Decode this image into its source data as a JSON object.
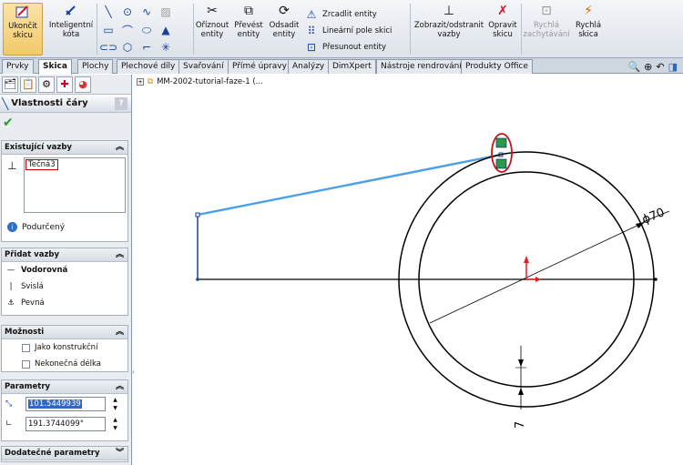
{
  "ribbon": {
    "exit_sketch": "Ukončit skicu",
    "smart_dimension": "Inteligentní kóta",
    "trim": "Oříznout entity",
    "convert": "Převést entity",
    "offset": "Odsadit entity",
    "mirror": "Zrcadlit entity",
    "linear_pattern": "Lineární pole skici",
    "move": "Přesunout entity",
    "display_relations": "Zobrazit/odstranit vazby",
    "repair": "Opravit skicu",
    "quick_snaps": "Rychlá zachytávání",
    "rapid_sketch": "Rychlá skica"
  },
  "tabs": [
    "Prvky",
    "Skica",
    "Plochy",
    "Plechové díly",
    "Svařování",
    "Přímé úpravy",
    "Analýzy",
    "DimXpert",
    "Nástroje rendrování",
    "Produkty Office"
  ],
  "selected_tab": "Skica",
  "tree_path": "MM-2002-tutorial-faze-1  (...",
  "panel": {
    "title": "Vlastnosti čáry",
    "help": "?",
    "existing_relations": "Existující vazby",
    "relation_item": "Tečná3",
    "status": "Podurčený",
    "add_relations": "Přidat vazby",
    "horizontal": "Vodorovná",
    "vertical": "Svislá",
    "fixed": "Pevná",
    "options": "Možnosti",
    "construction": "Jako konstrukční",
    "infinite": "Nekonečná délka",
    "parameters": "Parametry",
    "length": "101.5449939",
    "angle": "191.3744099°",
    "additional": "Dodatečné parametry"
  },
  "drawing": {
    "dimension_label": "ϕ70",
    "small_dimension": "7"
  }
}
